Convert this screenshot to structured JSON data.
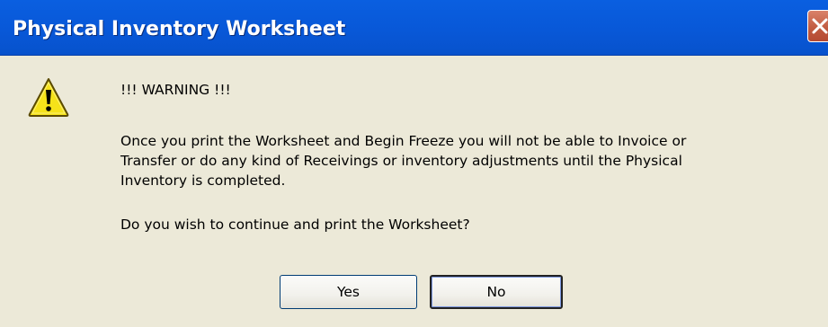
{
  "window": {
    "title": "Physical Inventory Worksheet"
  },
  "titlebar": {
    "close_icon": "close-icon"
  },
  "dialog": {
    "icon": "warning-icon",
    "warning_label": "!!! WARNING !!!",
    "message_lines": [
      "Once you print the Worksheet and Begin Freeze you will not be able to Invoice or",
      "Transfer or do any kind of Receivings or inventory adjustments until the Physical",
      "Inventory is completed."
    ],
    "question": "Do you wish to continue and print the Worksheet?"
  },
  "buttons": {
    "yes_label": "Yes",
    "no_label": "No"
  },
  "colors": {
    "titlebar": "#0858d8",
    "dialog_background": "#ece9d8",
    "warning_yellow": "#f5e21a"
  }
}
